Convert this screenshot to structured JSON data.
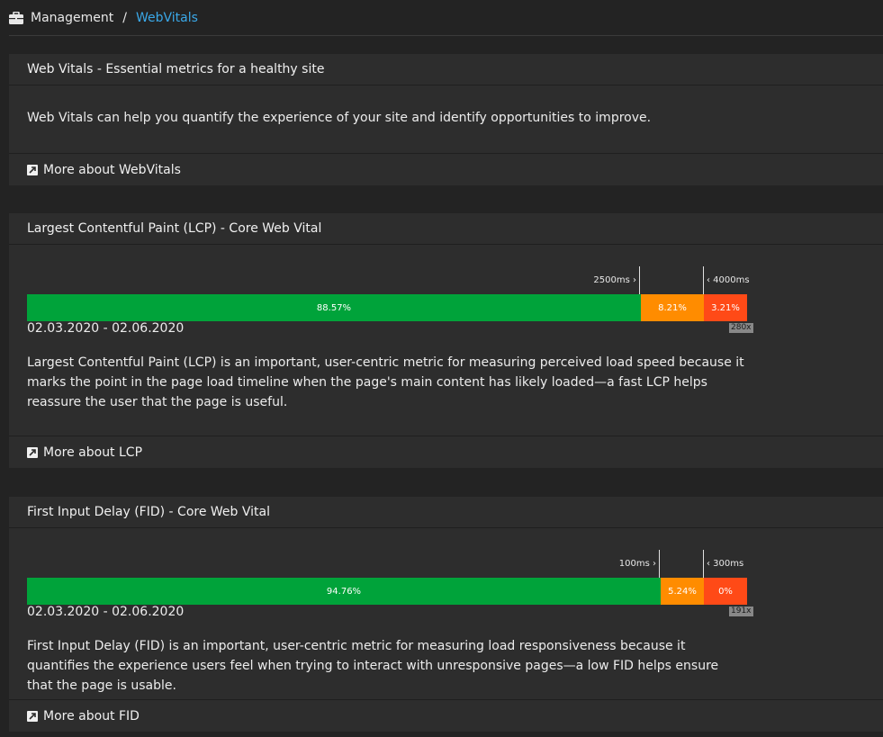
{
  "breadcrumb": {
    "root": "Management",
    "separator": "/",
    "current": "WebVitals",
    "icon": "briefcase-icon"
  },
  "intro": {
    "title": "Web Vitals - Essential metrics for a healthy site",
    "text": "Web Vitals can help you quantify the experience of your site and identify opportunities to improve.",
    "link": "More about WebVitals"
  },
  "lcp": {
    "title": "Largest Contentful Paint (LCP) - Core Web Vital",
    "threshold_good": "2500ms ›",
    "threshold_poor": "‹ 4000ms",
    "good_pct": 88.57,
    "improve_pct": 8.21,
    "poor_pct": 3.21,
    "good_label": "88.57%",
    "improve_label": "8.21%",
    "poor_label": "3.21%",
    "date": "02.03.2020 - 02.06.2020",
    "count": "280x",
    "description": "Largest Contentful Paint (LCP) is an important, user-centric metric for measuring perceived load speed because it marks the point in the page load timeline when the page's main content has likely loaded—a fast LCP helps reassure the user that the page is useful.",
    "link": "More about LCP"
  },
  "fid": {
    "title": "First Input Delay (FID) - Core Web Vital",
    "threshold_good": "100ms ›",
    "threshold_poor": "‹ 300ms",
    "good_pct": 94.76,
    "improve_pct": 5.24,
    "poor_pct": 0,
    "good_label": "94.76%",
    "improve_label": "5.24%",
    "poor_label": "0%",
    "date": "02.03.2020 - 02.06.2020",
    "count": "191x",
    "description": "First Input Delay (FID) is an important, user-centric metric for measuring load responsiveness because it quantifies the experience users feel when trying to interact with unresponsive pages—a low FID helps ensure that the page is usable.",
    "link": "More about FID"
  },
  "colors": {
    "good": "#00a33a",
    "improve": "#ff8c00",
    "poor": "#ff4a17",
    "link": "#3aa8e8"
  }
}
